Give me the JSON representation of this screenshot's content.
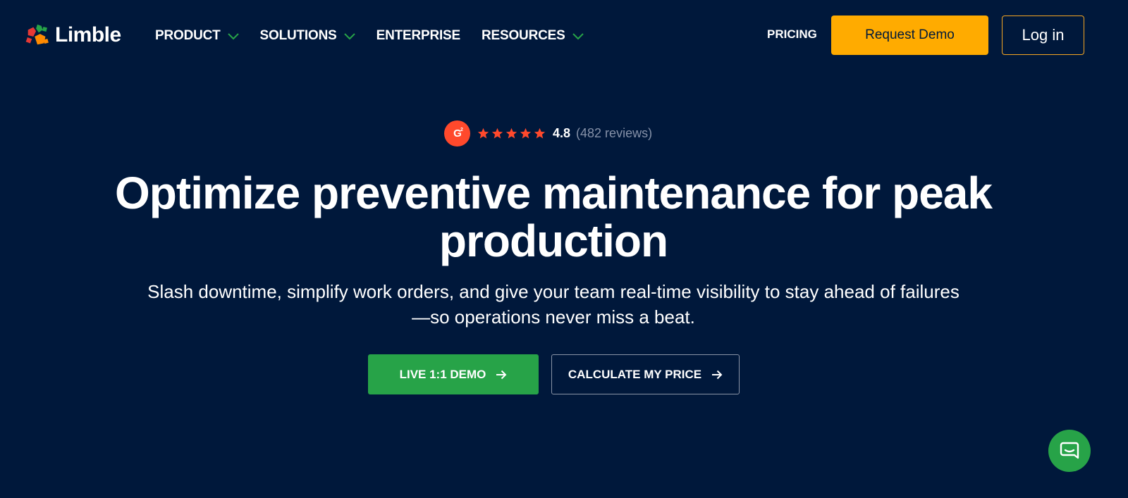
{
  "brand": {
    "name": "Limble"
  },
  "nav": {
    "items": [
      {
        "label": "PRODUCT",
        "has_dropdown": true
      },
      {
        "label": "SOLUTIONS",
        "has_dropdown": true
      },
      {
        "label": "ENTERPRISE",
        "has_dropdown": false
      },
      {
        "label": "RESOURCES",
        "has_dropdown": true
      }
    ],
    "pricing": "PRICING",
    "request_demo": "Request Demo",
    "login": "Log in"
  },
  "rating": {
    "badge_icon": "g2-logo-icon",
    "stars": 5,
    "score": "4.8",
    "reviews": "(482 reviews)"
  },
  "hero": {
    "headline": "Optimize preventive maintenance for peak production",
    "subtext": "Slash downtime, simplify work orders, and give your team real-time visibility to stay ahead of failures—so operations never miss a beat."
  },
  "cta": {
    "primary": "LIVE 1:1 DEMO",
    "secondary": "CALCULATE MY PRICE"
  },
  "chat": {
    "icon": "chat-bubble-icon"
  },
  "colors": {
    "background": "#00183b",
    "accent_orange": "#ffab00",
    "accent_green": "#27a348",
    "g2_red": "#ff492c",
    "star_color": "#ff492c"
  }
}
